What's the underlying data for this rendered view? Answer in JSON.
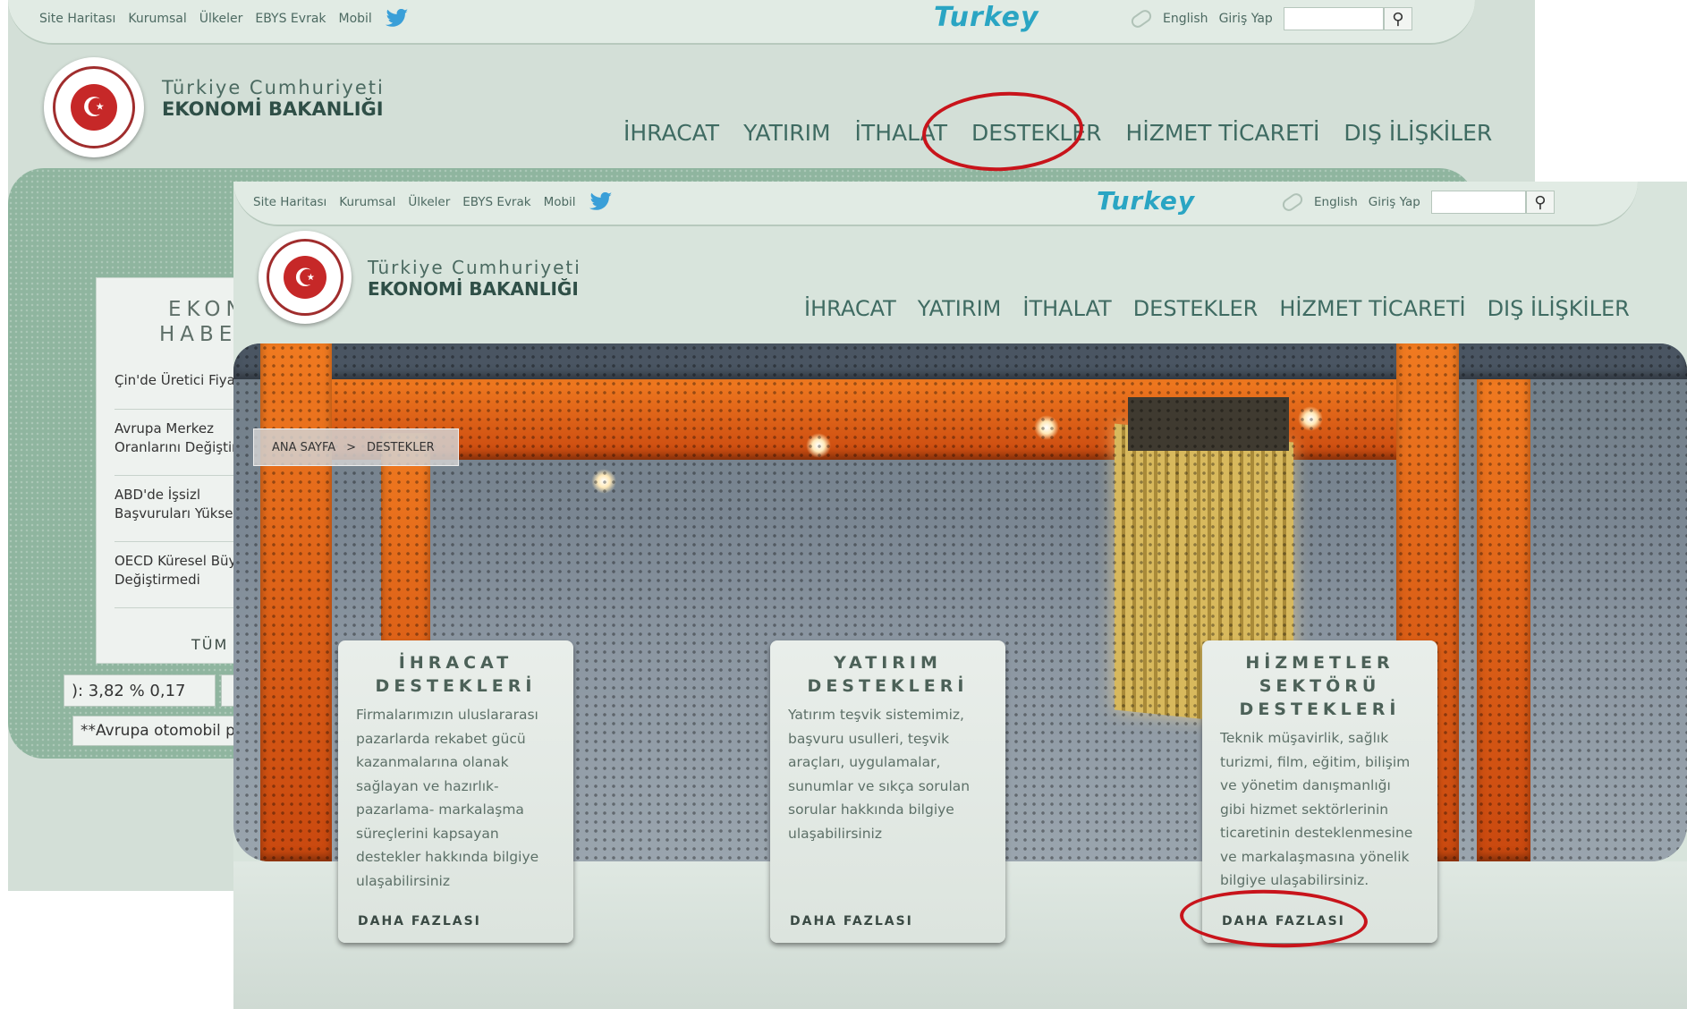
{
  "back_page": {
    "top_links": [
      "Site Haritası",
      "Kurumsal",
      "Ülkeler",
      "EBYS Evrak",
      "Mobil"
    ],
    "brand": "Turkey",
    "english_label": "English",
    "login_label": "Giriş Yap",
    "org_line1": "Türkiye Cumhuriyeti",
    "org_line2": "EKONOMİ BAKANLIĞI",
    "nav": [
      "İHRACAT",
      "YATIRIM",
      "İTHALAT",
      "DESTEKLER",
      "HİZMET TİCARETİ",
      "DIŞ İLİŞKİLER"
    ],
    "news_title_line1": "EKON",
    "news_title_line2": "HABER",
    "news_items": [
      "Çin'de Üretici Fiyat",
      "Avrupa Merkez Oranlarını Değiştir",
      "ABD'de İşsizl Başvuruları Yüksel",
      "OECD Küresel Büy Değiştirmedi"
    ],
    "news_all": "TÜM H",
    "ticker_value": "): 3,82   % 0,17",
    "ticker_note": "**Avrupa otomobil p"
  },
  "front_page": {
    "top_links": [
      "Site Haritası",
      "Kurumsal",
      "Ülkeler",
      "EBYS Evrak",
      "Mobil"
    ],
    "brand": "Turkey",
    "english_label": "English",
    "login_label": "Giriş Yap",
    "org_line1": "Türkiye Cumhuriyeti",
    "org_line2": "EKONOMİ BAKANLIĞI",
    "nav": [
      "İHRACAT",
      "YATIRIM",
      "İTHALAT",
      "DESTEKLER",
      "HİZMET TİCARETİ",
      "DIŞ İLİŞKİLER"
    ],
    "breadcrumb": {
      "home": "ANA SAYFA",
      "separator": ">",
      "current": "DESTEKLER"
    },
    "cards": [
      {
        "title_lines": [
          "İHRACAT",
          "DESTEKLERİ"
        ],
        "text": "Firmalarımızın uluslararası pazarlarda rekabet gücü kazanmalarına olanak sağlayan ve hazırlık-pazarlama- markalaşma süreçlerini kapsayan destekler hakkında bilgiye ulaşabilirsiniz",
        "more": "DAHA FAZLASI"
      },
      {
        "title_lines": [
          "YATIRIM",
          "DESTEKLERİ"
        ],
        "text": "Yatırım teşvik sistemimiz, başvuru usulleri, teşvik araçları, uygulamalar, sunumlar ve sıkça sorulan sorular hakkında bilgiye ulaşabilirsiniz",
        "more": "DAHA FAZLASI"
      },
      {
        "title_lines": [
          "HİZMETLER",
          "SEKTÖRÜ",
          "DESTEKLERİ"
        ],
        "text": "Teknik müşavirlik, sağlık turizmi, film, eğitim, bilişim ve yönetim danışmanlığı gibi hizmet sektörlerinin ticaretinin desteklenmesine ve markalaşmasına yönelik bilgiye ulaşabilirsiniz.",
        "more": "DAHA FAZLASI"
      }
    ]
  },
  "colors": {
    "highlight_oval": "#c8141b",
    "brand": "#2aa5c3",
    "nav_text": "#3f6b62"
  }
}
